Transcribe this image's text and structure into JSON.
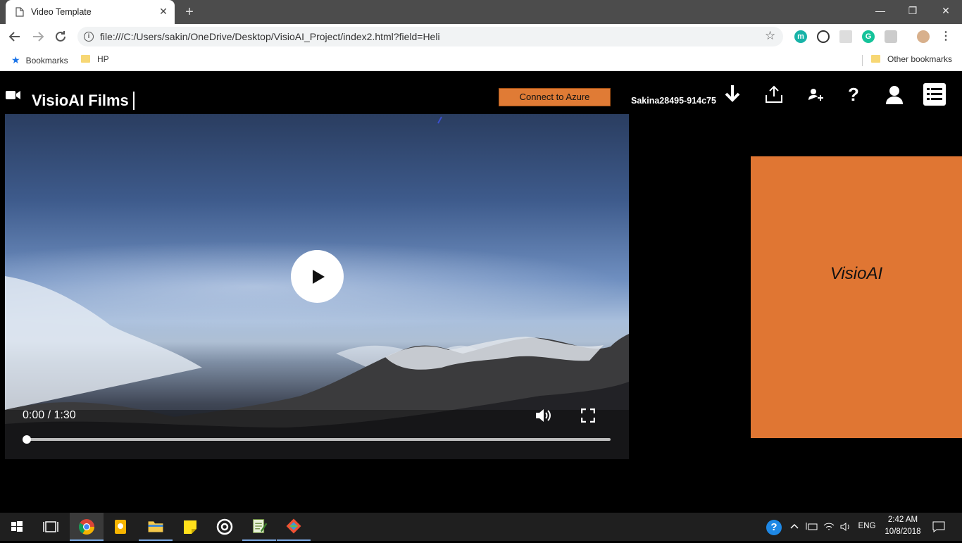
{
  "browser": {
    "tab_title": "Video Template",
    "tab_close": "✕",
    "new_tab": "+",
    "window_controls": {
      "minimize": "—",
      "restore": "❐",
      "close": "✕"
    },
    "url": "file:///C:/Users/sakin/OneDrive/Desktop/VisioAI_Project/index2.html?field=Heli",
    "extension_m_label": "m",
    "bookmarks": [
      "Bookmarks",
      "HP"
    ],
    "other_bookmarks": "Other bookmarks"
  },
  "page": {
    "brand": "VisioAI Films",
    "azure_button": "Connect to Azure",
    "user_id": "Sakina28495-914c75",
    "header_icons": [
      "download-icon",
      "upload-icon",
      "add-user-icon",
      "help-icon",
      "account-icon",
      "menu-list-icon"
    ],
    "help_label": "?"
  },
  "video": {
    "time": "0:00 / 1:30",
    "progress": 0.0
  },
  "side_panel": {
    "label": "VisioAI",
    "color": "#e07633"
  },
  "taskbar": {
    "apps": [
      "windows-start-icon",
      "task-view-icon",
      "chrome-icon",
      "keep-icon",
      "file-explorer-icon",
      "sticky-notes-icon",
      "groove-icon",
      "notepad-icon",
      "git-icon"
    ],
    "help_label": "?",
    "language": "ENG",
    "time": "2:42 AM",
    "date": "10/8/2018"
  }
}
